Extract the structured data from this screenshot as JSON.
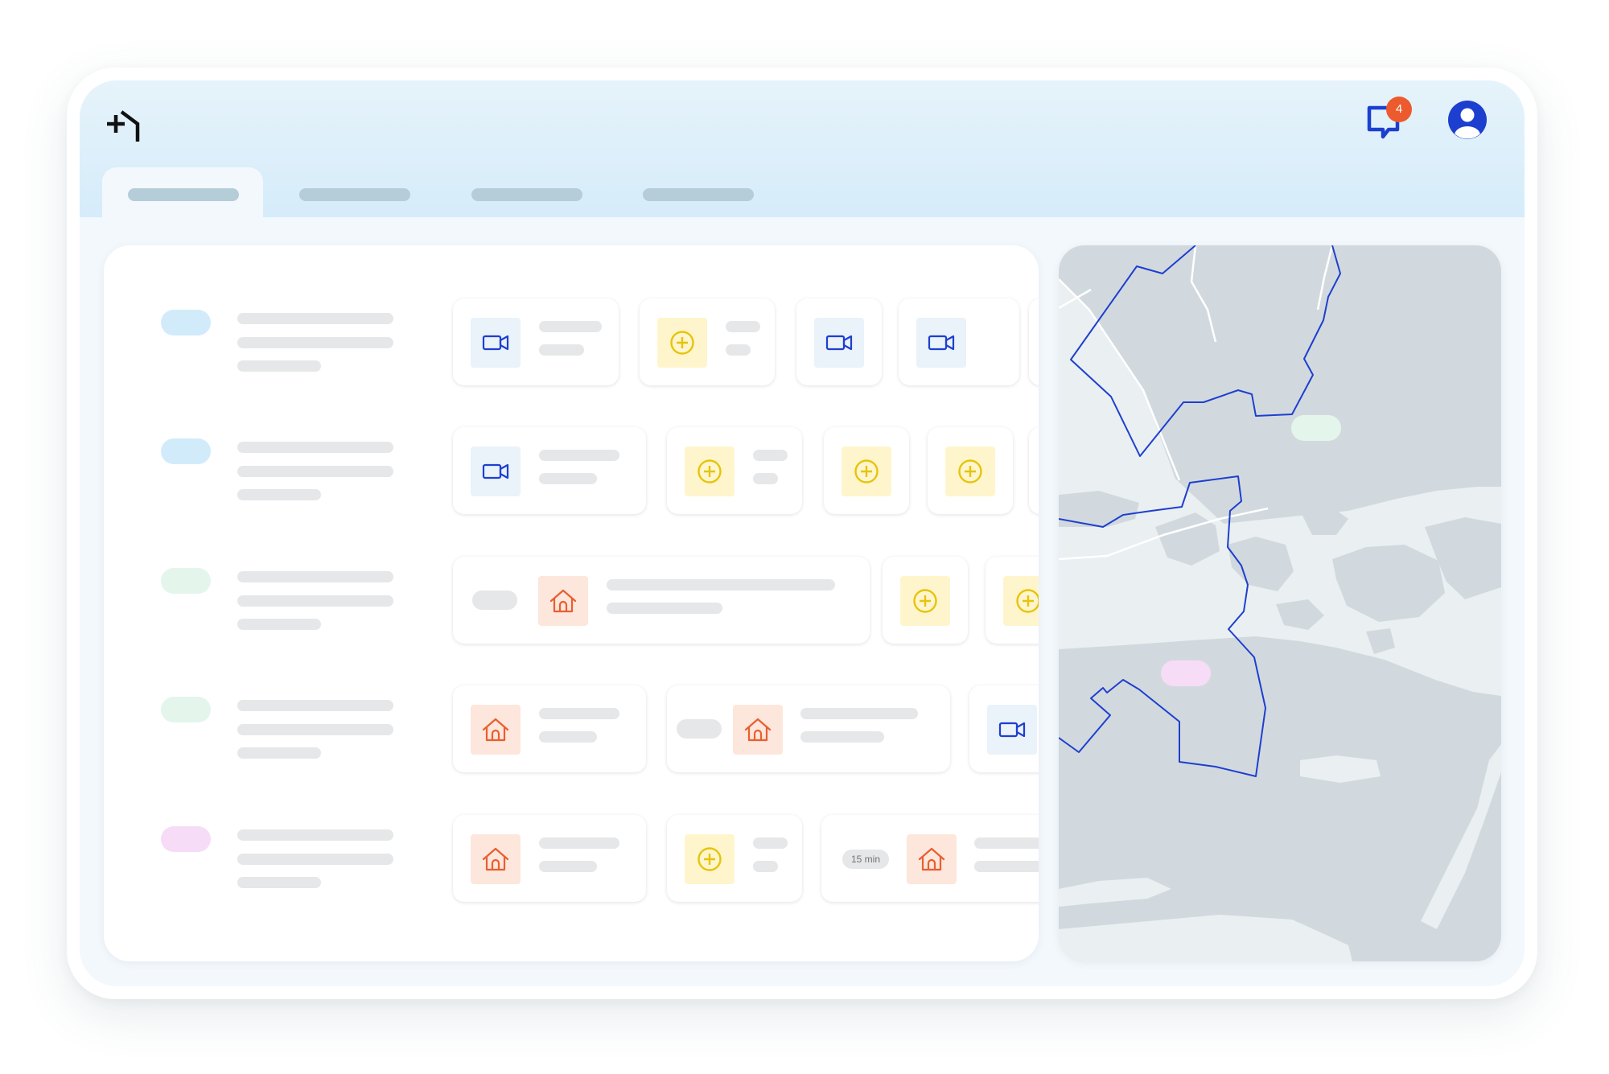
{
  "header": {
    "notifications": {
      "count": "4"
    }
  },
  "tabs": [
    {
      "label": "",
      "active": true
    },
    {
      "label": "",
      "active": false
    },
    {
      "label": "",
      "active": false
    },
    {
      "label": "",
      "active": false
    }
  ],
  "icons": {
    "logo": "plus-house-logo-icon",
    "chat": "chat-bubble-icon",
    "avatar": "user-avatar-icon",
    "video": "video-camera-icon",
    "plus": "add-circle-icon",
    "home": "house-icon"
  },
  "colors": {
    "accent_blue": "#1d3fcf",
    "notification_badge": "#ec5a2d",
    "plus_yellow": "#e6c40c",
    "home_orange": "#e85f30",
    "pill_blue": "#d1ebfb",
    "pill_green": "#e4f5ec",
    "pill_pink": "#f7dcf7",
    "map_land": "#d2d9de",
    "map_water": "#eaeff1"
  },
  "schedule": {
    "rows": [
      {
        "status_color": "#d1ebfb",
        "cards": [
          "video",
          "plus",
          "video",
          "video"
        ]
      },
      {
        "status_color": "#d1ebfb",
        "cards": [
          "video",
          "plus",
          "plus",
          "plus"
        ]
      },
      {
        "status_color": "#e4f5ec",
        "cards": [
          "home",
          "plus",
          "plus"
        ]
      },
      {
        "status_color": "#e4f5ec",
        "cards": [
          "home",
          "home",
          "video"
        ]
      },
      {
        "status_color": "#f7dcf7",
        "cards": [
          "home",
          "plus",
          "home"
        ],
        "duration_label": "15 min"
      }
    ]
  }
}
